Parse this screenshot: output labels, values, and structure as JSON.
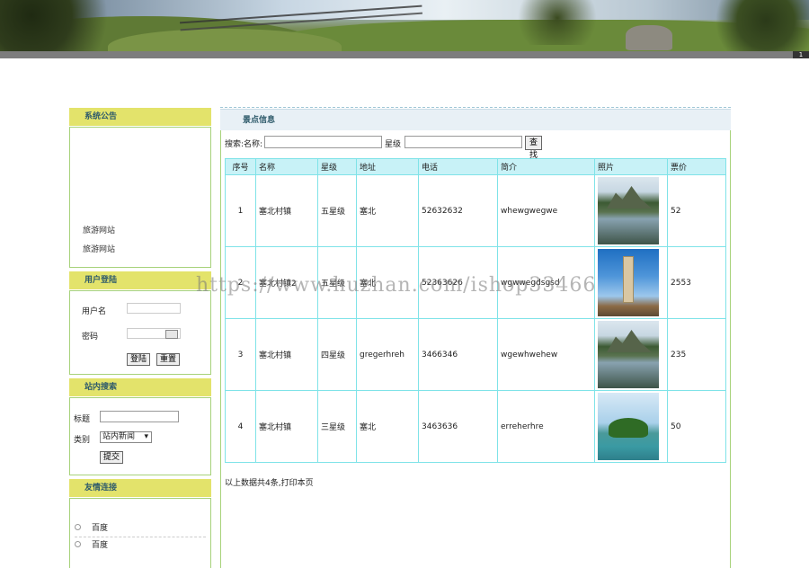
{
  "header": {
    "page_badge": "1"
  },
  "sidebar": {
    "notice": {
      "title": "系统公告",
      "links": [
        "旅游网站",
        "旅游网站"
      ]
    },
    "login": {
      "title": "用户登陆",
      "username_label": "用户名",
      "password_label": "密码",
      "login_button": "登陆",
      "reset_button": "重置"
    },
    "site_search": {
      "title": "站内搜索",
      "title_label": "标题",
      "category_label": "类别",
      "category_selected": "站内新闻",
      "submit_button": "提交"
    },
    "friend_links": {
      "title": "友情连接",
      "links": [
        "百度",
        "百度"
      ]
    }
  },
  "main": {
    "title": "景点信息",
    "search": {
      "label_name": "搜索:名称:",
      "label_star": "星级",
      "button": "查找"
    },
    "table": {
      "headers": [
        "序号",
        "名称",
        "星级",
        "地址",
        "电话",
        "简介",
        "照片",
        "票价"
      ],
      "rows": [
        {
          "idx": "1",
          "name": "塞北村镇",
          "star": "五星级",
          "address": "塞北",
          "phone": "52632632",
          "intro": "whewgwegwe",
          "photo": "mountain-lake",
          "price": "52"
        },
        {
          "idx": "2",
          "name": "塞北村镇2",
          "star": "五星级",
          "address": "塞北",
          "phone": "52363626",
          "intro": "wgwwegdsgsd",
          "photo": "tower",
          "price": "2553"
        },
        {
          "idx": "3",
          "name": "塞北村镇",
          "star": "四星级",
          "address": "gregerhreh",
          "phone": "3466346",
          "intro": "wgewhwehew",
          "photo": "mountain-lake",
          "price": "235"
        },
        {
          "idx": "4",
          "name": "塞北村镇",
          "star": "三星级",
          "address": "塞北",
          "phone": "3463636",
          "intro": "erreherhre",
          "photo": "island",
          "price": "50"
        }
      ]
    },
    "footer_note": "以上数据共4条,打印本页"
  },
  "watermark": "https://www.huzhan.com/ishop33466"
}
